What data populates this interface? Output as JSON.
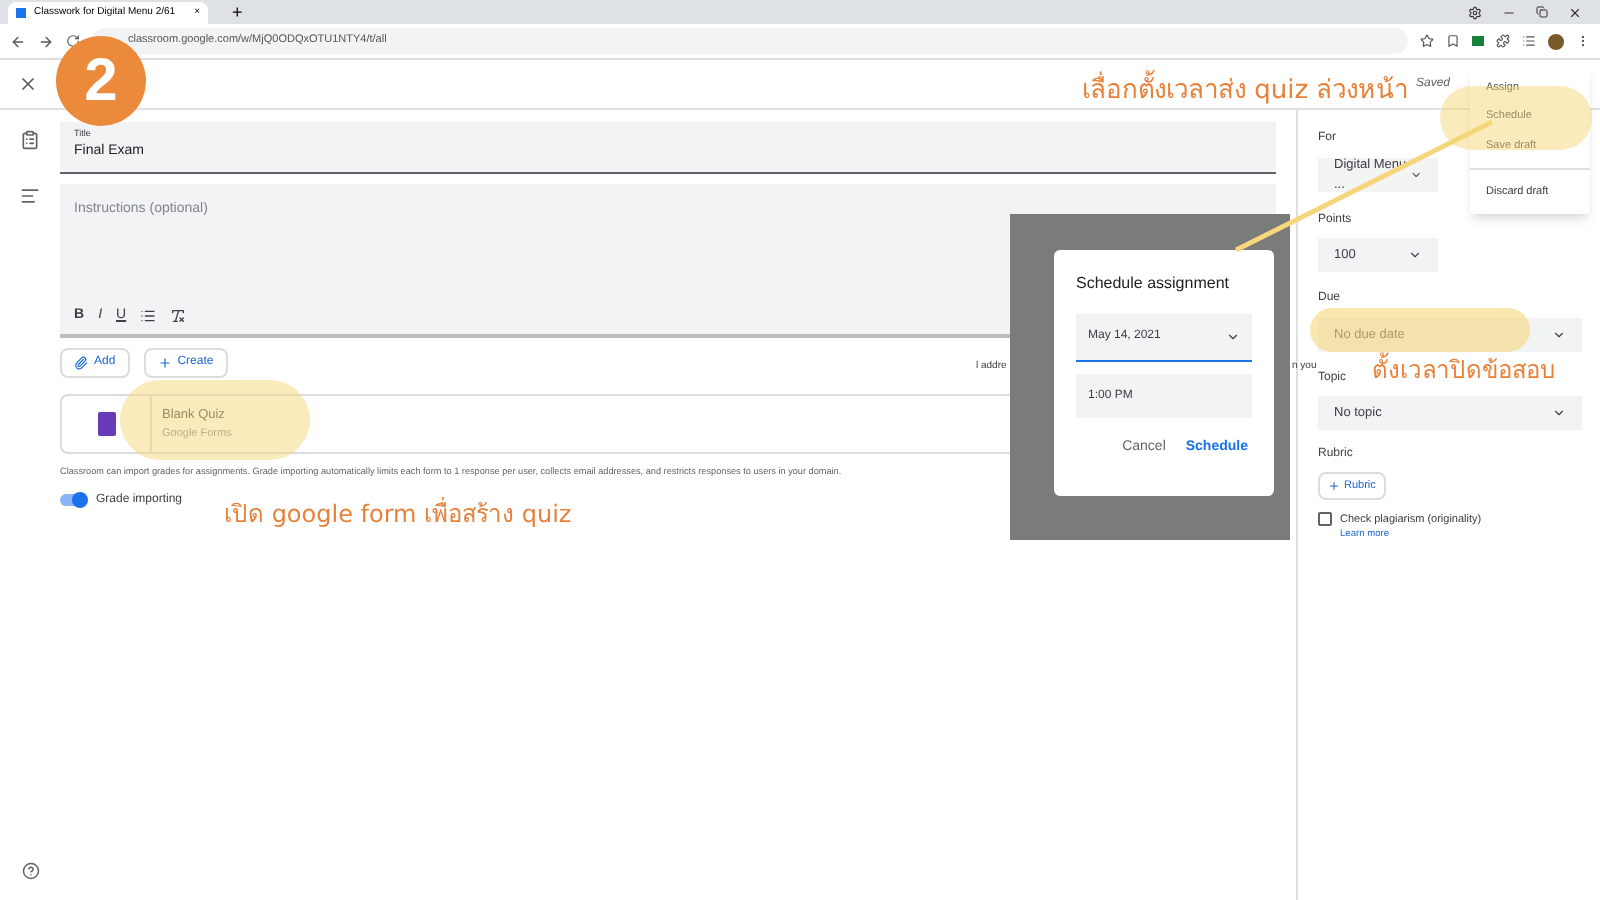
{
  "browser": {
    "tab_title": "Classwork for Digital Menu 2/61",
    "tab_close": "×",
    "new_tab": "+",
    "url": "classroom.google.com/w/MjQ0ODQxOTU1NTY4/t/all"
  },
  "header": {
    "status": "Saved"
  },
  "step_badge": "2",
  "form": {
    "title": {
      "label": "Title",
      "value": "Final Exam"
    },
    "instructions": {
      "placeholder": "Instructions (optional)"
    },
    "format_tools": [
      "B",
      "I",
      "U"
    ],
    "buttons": [
      {
        "kind": "add",
        "label": "Add"
      },
      {
        "kind": "create",
        "label": "Create"
      }
    ],
    "attachment": {
      "name": "Blank Quiz",
      "type": "Google Forms"
    },
    "notice": "Classroom can import grades for assignments. Grade importing automatically limits each form to 1 response per user, collects email addresses, and restricts responses to users in your domain.",
    "notice_fragments": [
      "l addre",
      "n you"
    ],
    "grade_importing": {
      "label": "Grade importing",
      "on": true
    }
  },
  "settings": {
    "for": {
      "label": "For",
      "value": "Digital Menu ..."
    },
    "points": {
      "label": "Points",
      "value": "100"
    },
    "due": {
      "label": "Due",
      "value": "No due date"
    },
    "topic": {
      "label": "Topic",
      "value": "No topic"
    },
    "rubric": {
      "label": "Rubric",
      "button": "Rubric"
    },
    "plagiarism": {
      "label": "Check plagiarism (originality)",
      "link": "Learn more",
      "checked": false
    }
  },
  "assign_menu": [
    {
      "label": "Assign",
      "divider_before": false
    },
    {
      "label": "Schedule",
      "divider_before": false
    },
    {
      "label": "Save draft",
      "divider_before": false
    },
    {
      "label": "Discard draft",
      "divider_before": true
    }
  ],
  "dialog": {
    "title": "Schedule assignment",
    "date": "May 14, 2021",
    "time": "1:00 PM",
    "buttons": [
      {
        "label": "Cancel",
        "primary": false
      },
      {
        "label": "Schedule",
        "primary": true
      }
    ]
  },
  "annotations": [
    {
      "kind": "menu",
      "text": "เลื่อกตั้งเวลาส่ง quiz ล่วงหน้า"
    },
    {
      "kind": "form",
      "text": "เปิด google form เพื่อสร้าง quiz"
    },
    {
      "kind": "due",
      "text": "ตั้งเวลาปิดข้อสอบ"
    }
  ]
}
